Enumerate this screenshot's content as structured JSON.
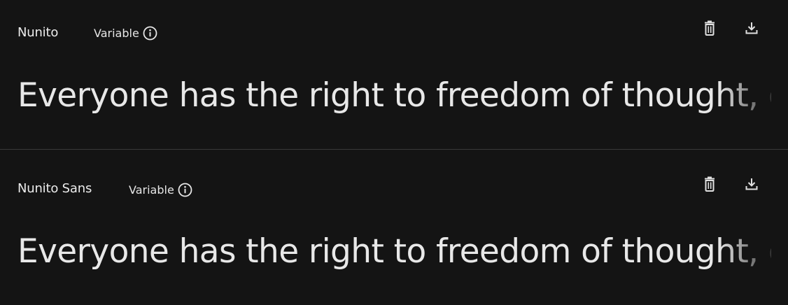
{
  "fonts": [
    {
      "family": "Nunito",
      "badge": "Variable",
      "preview": "Everyone has the right to freedom of thought, conscience and religion"
    },
    {
      "family": "Nunito Sans",
      "badge": "Variable",
      "preview": "Everyone has the right to freedom of thought, conscience and religion"
    }
  ],
  "icons": {
    "info": "info-icon",
    "delete": "trash-icon",
    "download": "download-icon"
  },
  "colors": {
    "background": "#141414",
    "text": "#e8e8e8",
    "divider": "#3a3a3a"
  }
}
